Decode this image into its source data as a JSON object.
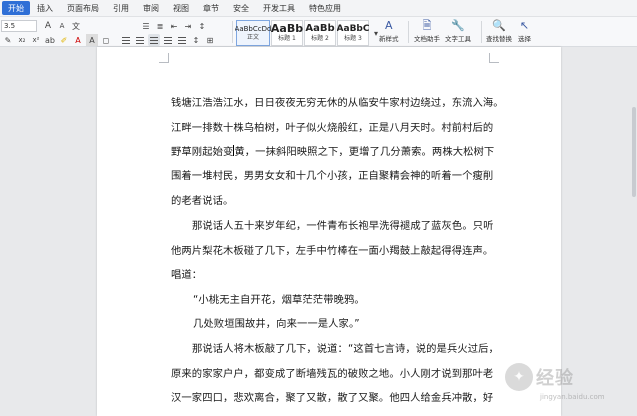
{
  "menu": {
    "tabs": [
      "开始",
      "插入",
      "页面布局",
      "引用",
      "审阅",
      "视图",
      "章节",
      "安全",
      "开发工具",
      "特色应用"
    ],
    "active": "开始"
  },
  "ribbon": {
    "font_size": "3.5",
    "row1_icons": [
      "A",
      "A",
      "文"
    ],
    "styles": [
      {
        "sample": "AaBbCcDd",
        "name": "正文"
      },
      {
        "sample": "AaBb",
        "name": "标题 1"
      },
      {
        "sample": "AaBb",
        "name": "标题 2"
      },
      {
        "sample": "AaBbC",
        "name": "标题 3"
      }
    ],
    "new_style": "新样式",
    "doc_assistant": "文档助手",
    "text_tools": "文字工具",
    "find_replace": "查找替换",
    "select": "选择"
  },
  "document": {
    "lines": [
      "钱塘江浩浩江水，日日夜夜无穷无休的从临安牛家村边绕过，东流入海。",
      "江畔一排数十株乌柏树，叶子似火烧般红，正是八月天时。村前村后的",
      "野草刚起始变",
      "黄，一抹斜阳映照之下，更增了几分萧索。两株大松树下",
      "围着一堆村民，男男女女和十几个小孩，正自聚精会神的听着一个瘦削",
      "的老者说话。",
      "那说话人五十来岁年纪，一件青布长袍早洗得褪成了蓝灰色。只听",
      "他两片梨花木板碰了几下，左手中竹棒在一面小羯鼓上敲起得得连声。",
      "唱道：",
      "“小桃无主自开花，烟草茫茫带晚鸦。",
      "几处败垣围故井，向来一一是人家。”",
      "那说话人将木板敲了几下，说道：“这首七言诗，说的是兵火过后，",
      "原来的家家户户，都变成了断墙残瓦的破败之地。小人刚才说到那叶老",
      "汉一家四口，悲欢离合，聚了又散，散了又聚。他四人给金兵冲散，好"
    ]
  },
  "watermark": {
    "text": "经验",
    "url": "jingyan.baidu.com"
  }
}
